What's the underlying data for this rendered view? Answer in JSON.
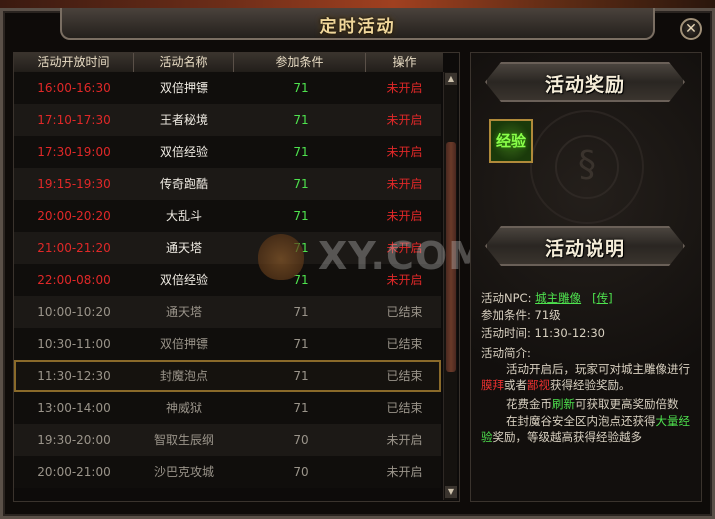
{
  "window": {
    "title": "定时活动",
    "close_label": "✕"
  },
  "table": {
    "headers": [
      "活动开放时间",
      "活动名称",
      "参加条件",
      "操作"
    ],
    "rows": [
      {
        "time": "16:00-16:30",
        "name": "双倍押镖",
        "cond": "71",
        "op": "未开启",
        "state": "upcoming"
      },
      {
        "time": "17:10-17:30",
        "name": "王者秘境",
        "cond": "71",
        "op": "未开启",
        "state": "upcoming"
      },
      {
        "time": "17:30-19:00",
        "name": "双倍经验",
        "cond": "71",
        "op": "未开启",
        "state": "upcoming"
      },
      {
        "time": "19:15-19:30",
        "name": "传奇跑酷",
        "cond": "71",
        "op": "未开启",
        "state": "upcoming"
      },
      {
        "time": "20:00-20:20",
        "name": "大乱斗",
        "cond": "71",
        "op": "未开启",
        "state": "upcoming"
      },
      {
        "time": "21:00-21:20",
        "name": "通天塔",
        "cond": "71",
        "op": "未开启",
        "state": "upcoming"
      },
      {
        "time": "22:00-08:00",
        "name": "双倍经验",
        "cond": "71",
        "op": "未开启",
        "state": "upcoming"
      },
      {
        "time": "10:00-10:20",
        "name": "通天塔",
        "cond": "71",
        "op": "已结束",
        "state": "ended"
      },
      {
        "time": "10:30-11:00",
        "name": "双倍押镖",
        "cond": "71",
        "op": "已结束",
        "state": "ended"
      },
      {
        "time": "11:30-12:30",
        "name": "封魔泡点",
        "cond": "71",
        "op": "已结束",
        "state": "selected"
      },
      {
        "time": "13:00-14:00",
        "name": "神威狱",
        "cond": "71",
        "op": "已结束",
        "state": "ended"
      },
      {
        "time": "19:30-20:00",
        "name": "智取生辰纲",
        "cond": "70",
        "op": "未开启",
        "state": "ended"
      },
      {
        "time": "20:00-21:00",
        "name": "沙巴克攻城",
        "cond": "70",
        "op": "未开启",
        "state": "ended"
      }
    ]
  },
  "right": {
    "reward_title": "活动奖励",
    "reward_icon_text": "经验",
    "desc_title": "活动说明",
    "npc_label": "活动NPC:",
    "npc_name": "城主雕像",
    "npc_teleport": "[传]",
    "cond_line": "参加条件: 71级",
    "time_line": "活动时间: 11:30-12:30",
    "intro_label": "活动简介:",
    "intro_1": "活动开启后，玩家可对城主雕像进行",
    "intro_2a": "膜拜",
    "intro_2b": "或者",
    "intro_2c": "鄙视",
    "intro_2d": "获得经验奖励。",
    "intro_3a": "花费金币",
    "intro_3b": "刷新",
    "intro_3c": "可获取更高奖励倍数",
    "intro_4a": "在封魔谷安全区内泡点还获得",
    "intro_4b": "大量经",
    "intro_5a": "验",
    "intro_5b": "奖励，等级越高获得经验越多"
  },
  "watermark": {
    "text": "XY.COM"
  },
  "colors": {
    "upcoming_time": "#e02828",
    "condition_ok": "#4ee24e",
    "ended": "#9a948a",
    "title_gold": "#f0d79a"
  }
}
